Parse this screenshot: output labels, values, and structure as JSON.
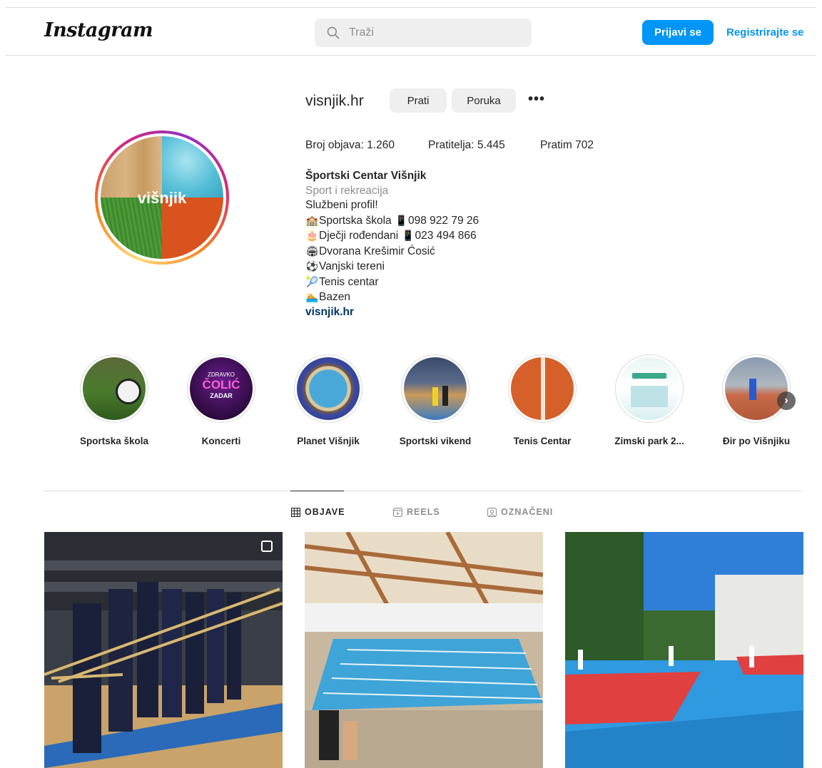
{
  "header": {
    "logo": "Instagram",
    "search_placeholder": "Traži",
    "login_label": "Prijavi se",
    "register_label": "Registrirajte se"
  },
  "profile": {
    "username": "visnjik.hr",
    "follow_label": "Prati",
    "message_label": "Poruka",
    "more_label": "•••",
    "avatar_text": "višnjik",
    "stats": {
      "posts": "Broj objava: 1.260",
      "followers": "Pratitelja: 5.445",
      "following": "Pratim 702"
    },
    "bio": {
      "name": "Športski Centar Višnjik",
      "category": "Sport i rekreacija",
      "line1": "Službeni profil!",
      "line2": "Sportska škola",
      "line2_phone": "098 922 79 26",
      "line3": "Dječji rođendani",
      "line3_phone": "023 494 866",
      "line4": "Dvorana Krešimir Ćosić",
      "line5": "Vanjski tereni",
      "line6": "Tenis centar",
      "line7": "Bazen",
      "link": "visnjik.hr"
    }
  },
  "highlights": [
    {
      "label": "Sportska škola"
    },
    {
      "label": "Koncerti"
    },
    {
      "label": "Planet Višnjik"
    },
    {
      "label": "Sportski vikend"
    },
    {
      "label": "Tenis Centar"
    },
    {
      "label": "Zimski park 2..."
    },
    {
      "label": "Đir po Višnjiku"
    }
  ],
  "highlight_art": {
    "koncerti_line1": "ZDRAVKO",
    "koncerti_line2": "ČOLIĆ",
    "koncerti_line3": "ZADAR"
  },
  "tabs": {
    "posts": "OBJAVE",
    "reels": "REELS",
    "tagged": "OZNAČENI"
  },
  "colors": {
    "accent": "#0095f6",
    "link": "#00376b"
  }
}
